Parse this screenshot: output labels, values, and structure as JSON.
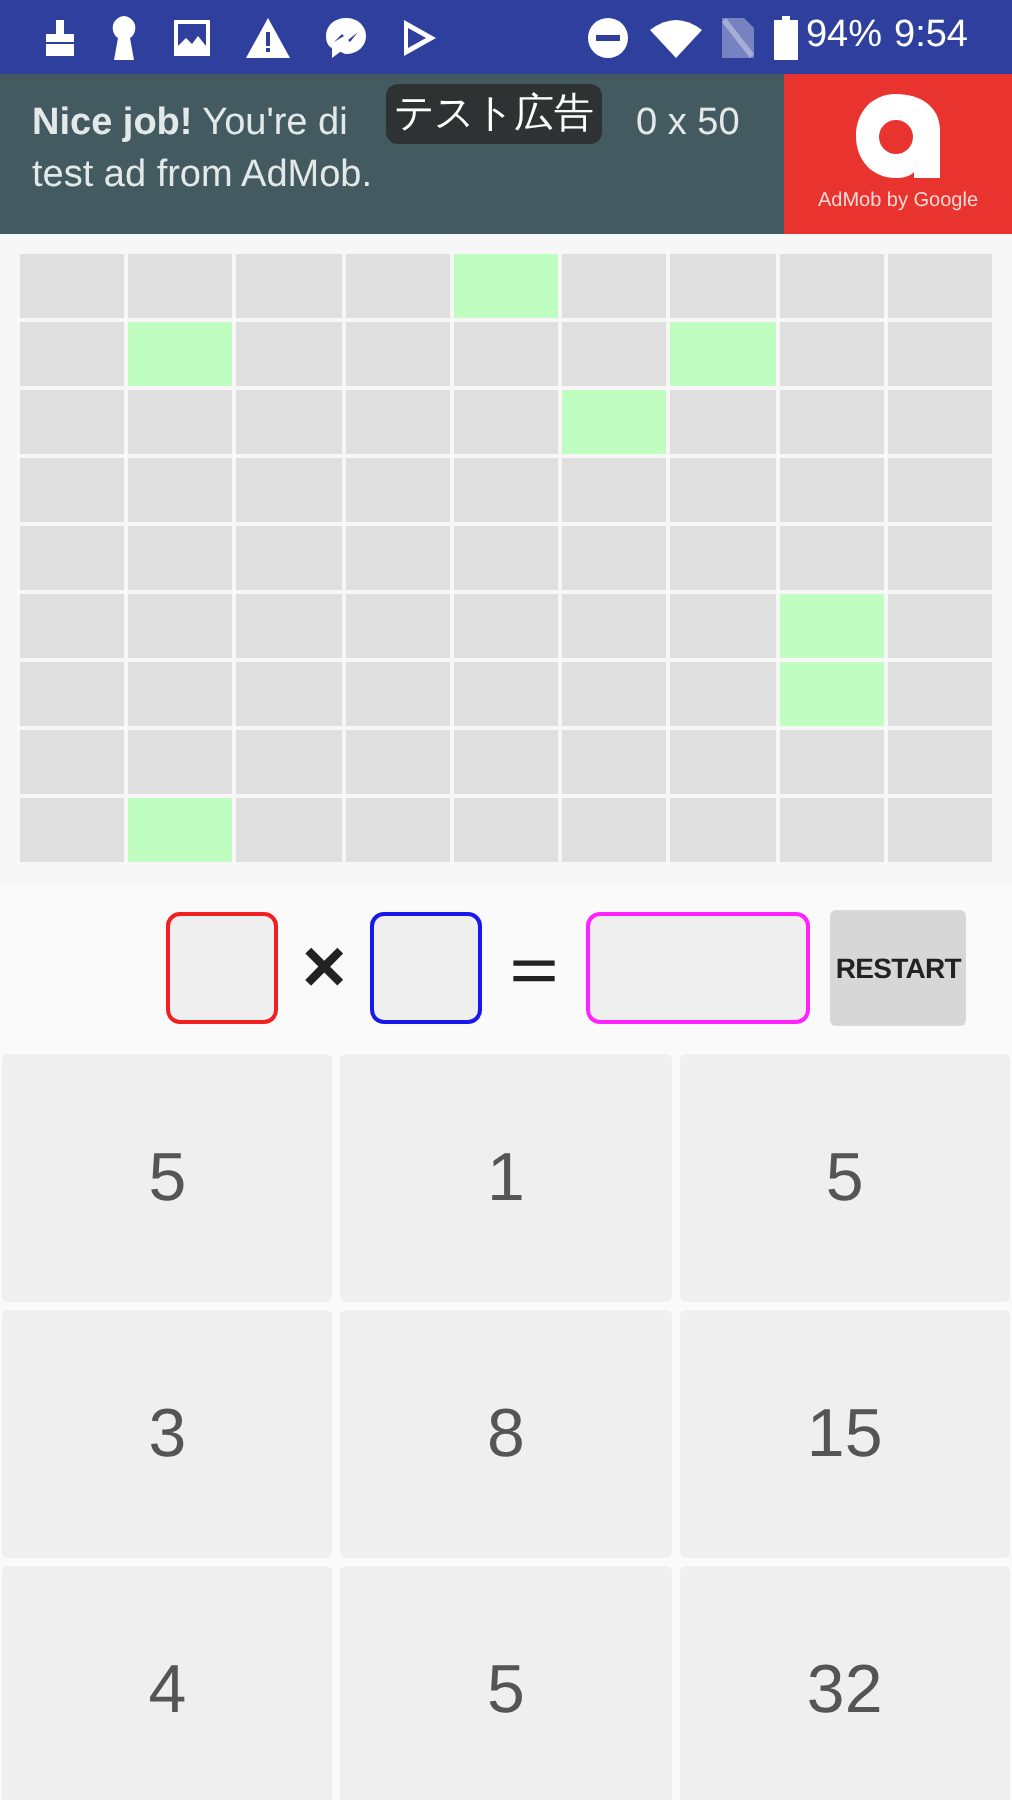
{
  "status_bar": {
    "battery": "94%",
    "time": "9:54"
  },
  "ad": {
    "line1_start": "**Nice job!** You're di",
    "line1_end": "0 x 50",
    "line2": "test ad from AdMob.",
    "overlay": "テスト広告",
    "logo_caption": "AdMob by Google"
  },
  "grid": {
    "rows": [
      {
        "cells": [
          false,
          false,
          false,
          false,
          true,
          false,
          false,
          false,
          false
        ]
      },
      {
        "cells": [
          false,
          true,
          false,
          false,
          false,
          false,
          true,
          false,
          false
        ]
      },
      {
        "cells": [
          false,
          false,
          false,
          false,
          false,
          true,
          false,
          false,
          false
        ]
      },
      {
        "cells": [
          false,
          false,
          false,
          false,
          false,
          false,
          false,
          false,
          false
        ]
      },
      {
        "cells": [
          false,
          false,
          false,
          false,
          false,
          false,
          false,
          false,
          false
        ]
      },
      {
        "cells": [
          false,
          false,
          false,
          false,
          false,
          false,
          false,
          true,
          false
        ]
      },
      {
        "cells": [
          false,
          false,
          false,
          false,
          false,
          false,
          false,
          true,
          false
        ]
      },
      {
        "cells": [
          false,
          false,
          false,
          false,
          false,
          false,
          false,
          false,
          false
        ]
      },
      {
        "cells": [
          false,
          true,
          false,
          false,
          false,
          false,
          false,
          false,
          false
        ]
      }
    ]
  },
  "equation": {
    "times": "×",
    "equals": "＝",
    "restart": "RESTART"
  },
  "keypad": [
    "5",
    "1",
    "5",
    "3",
    "8",
    "15",
    "4",
    "5",
    "32"
  ]
}
